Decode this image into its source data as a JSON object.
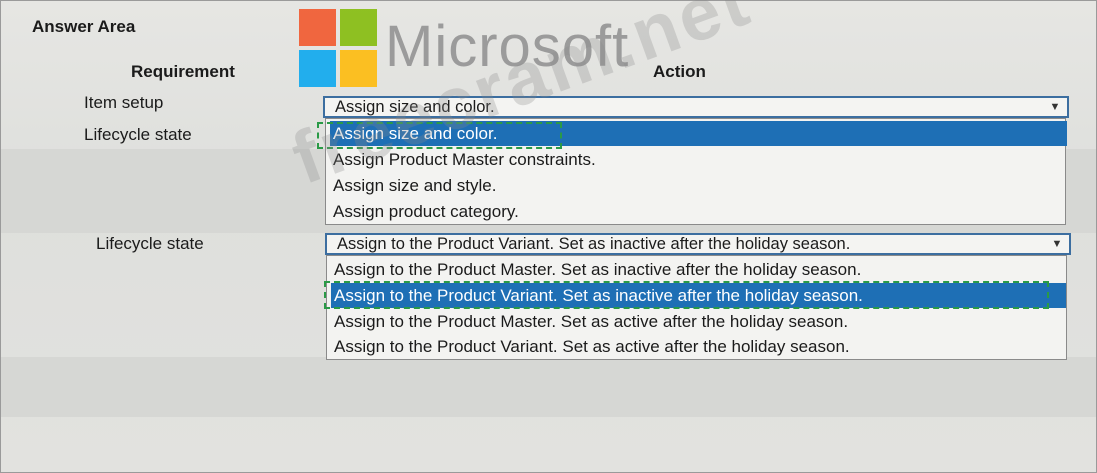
{
  "brand": {
    "name": "Microsoft",
    "logo_colors": [
      "#f25022",
      "#7fba00",
      "#00a4ef",
      "#ffb900"
    ]
  },
  "watermark": "freecram.net",
  "title": "Answer Area",
  "headers": {
    "requirement": "Requirement",
    "action": "Action"
  },
  "rows": [
    {
      "label": "Item setup",
      "selected_value": "Assign size and color.",
      "options": [
        "Assign size and color.",
        "Assign Product Master constraints.",
        "Assign size and style.",
        "Assign product category."
      ],
      "highlighted_index": 0
    },
    {
      "label": "Lifecycle state",
      "selected_value": "Assign to the Product Variant. Set as inactive after the holiday season.",
      "options": [
        "Assign to the Product Master. Set as inactive after the holiday season.",
        "Assign to the Product Variant. Set as inactive after the holiday season.",
        "Assign to the Product Master. Set as active after the holiday season.",
        "Assign to the Product Variant. Set as active after the holiday season."
      ],
      "highlighted_index": 1
    }
  ],
  "stray_label": "Lifecycle state",
  "accent_color": "#1e6fb5",
  "dashed_marker_color": "#2a9a46"
}
